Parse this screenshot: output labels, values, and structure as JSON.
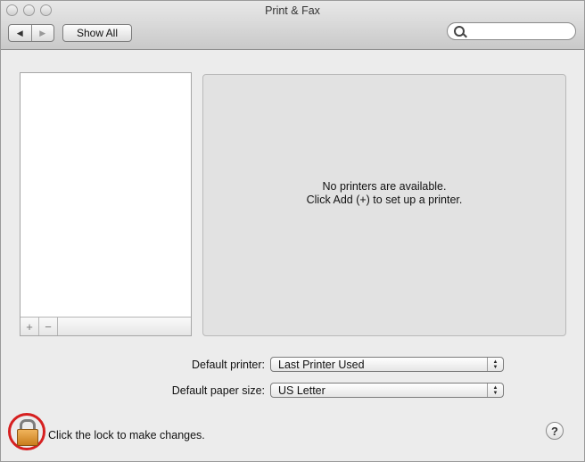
{
  "window": {
    "title": "Print & Fax"
  },
  "toolbar": {
    "back_icon": "◀",
    "forward_icon": "▶",
    "show_all_label": "Show All",
    "search_value": "",
    "search_placeholder": ""
  },
  "printers": {
    "items": [],
    "add_symbol": "+",
    "remove_symbol": "−",
    "empty_line1": "No printers are available.",
    "empty_line2": "Click Add (+) to set up a printer."
  },
  "settings": {
    "default_printer_label": "Default printer:",
    "default_printer_value": "Last Printer Used",
    "default_paper_label": "Default paper size:",
    "default_paper_value": "US Letter"
  },
  "footer": {
    "lock_text": "Click the lock to make changes.",
    "help_symbol": "?"
  },
  "colors": {
    "highlight_ring": "#d62020",
    "lock_body": "#e09a3c"
  }
}
